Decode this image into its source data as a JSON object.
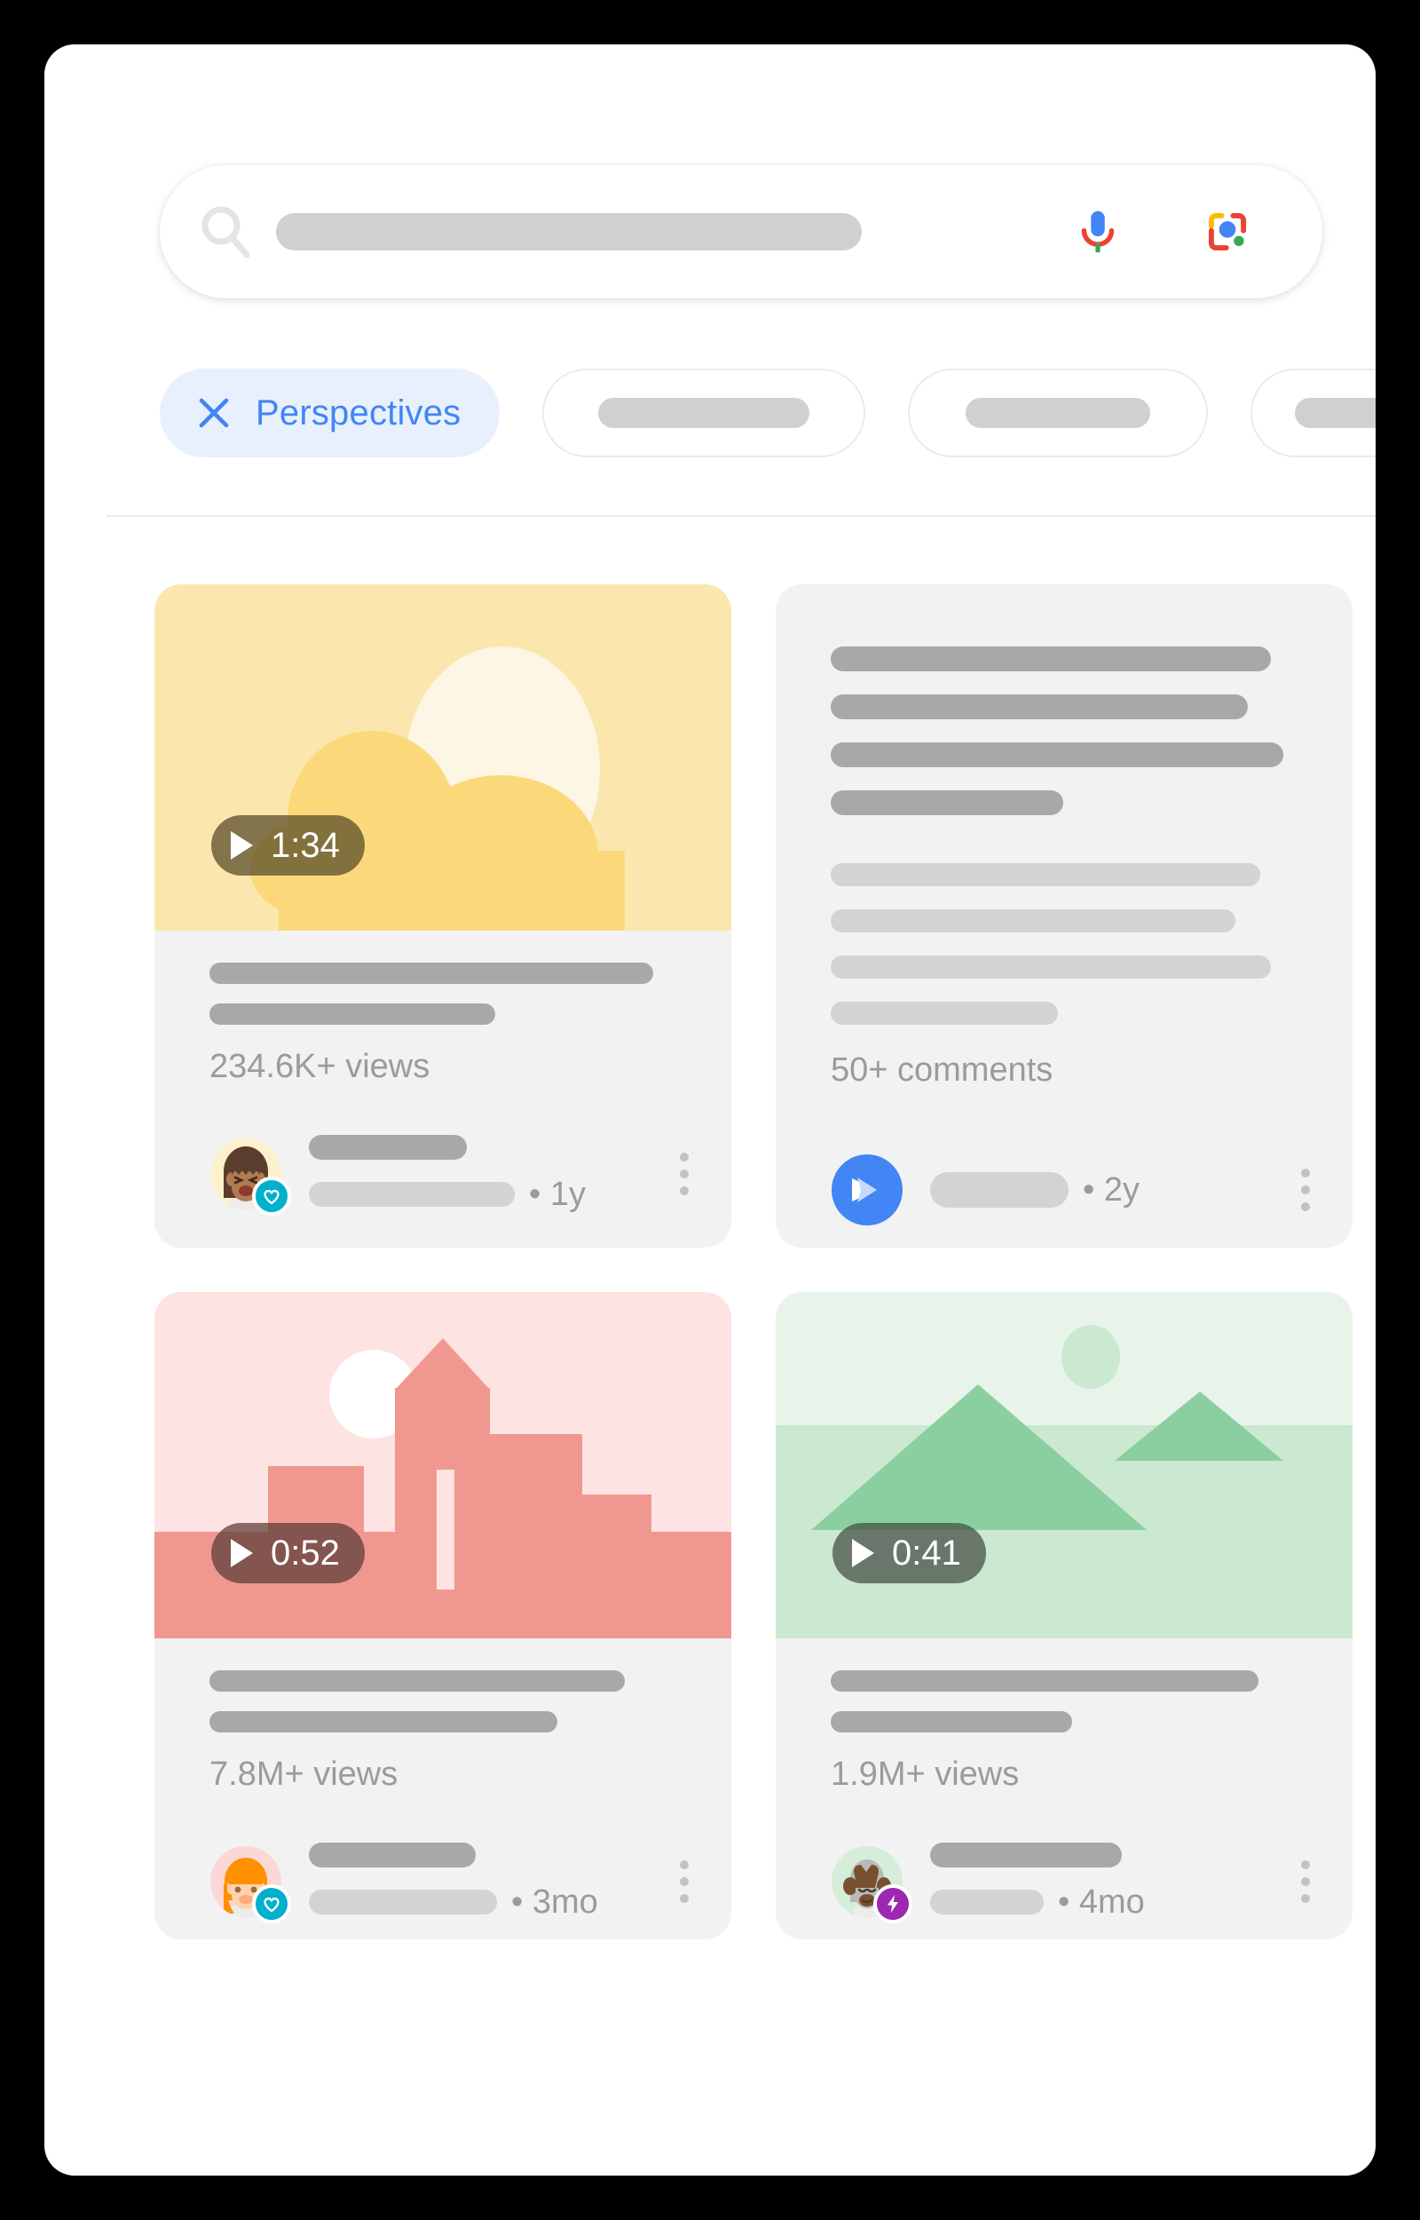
{
  "search": {
    "icon": "search-icon",
    "query_value": "",
    "placeholder": "",
    "mic_icon": "microphone-icon",
    "lens_icon": "google-lens-icon"
  },
  "filters": {
    "active_chip": {
      "label": "Perspectives",
      "icon": "close-icon",
      "color": "#4285f4",
      "background": "#e8f0fe"
    },
    "placeholder_chips": [
      {
        "label": ""
      },
      {
        "label": ""
      },
      {
        "label": ""
      }
    ]
  },
  "results": [
    {
      "type": "video",
      "thumbnail": "sun-cloud-illustration",
      "duration": "1:34",
      "duration_icon": "play-icon",
      "stat": "234.6K+ views",
      "avatar": "woman-avatar",
      "badge": "heart-badge",
      "badge_color": "#00b0cc",
      "age": "• 1y",
      "menu_icon": "overflow-menu-icon"
    },
    {
      "type": "comment",
      "stat": "50+ comments",
      "avatar": "google-chat-avatar",
      "badge": "",
      "badge_color": "",
      "age": "• 2y",
      "menu_icon": "overflow-menu-icon"
    },
    {
      "type": "video",
      "thumbnail": "city-skyline-illustration",
      "duration": "0:52",
      "duration_icon": "play-icon",
      "stat": "7.8M+ views",
      "avatar": "orange-hair-avatar",
      "badge": "heart-badge",
      "badge_color": "#00b0cc",
      "age": "• 3mo",
      "menu_icon": "overflow-menu-icon"
    },
    {
      "type": "video",
      "thumbnail": "mountain-landscape-illustration",
      "duration": "0:41",
      "duration_icon": "play-icon",
      "stat": "1.9M+ views",
      "avatar": "bison-avatar",
      "badge": "bolt-badge",
      "badge_color": "#9c27b0",
      "age": "• 4mo",
      "menu_icon": "overflow-menu-icon"
    }
  ],
  "colors": {
    "accent_blue": "#4285f4",
    "google_red": "#ea4335",
    "google_yellow": "#fbbc04",
    "google_green": "#34a853",
    "card_bg": "#f2f2f2",
    "page_bg": "#ffffff",
    "outer_bg": "#000000"
  }
}
